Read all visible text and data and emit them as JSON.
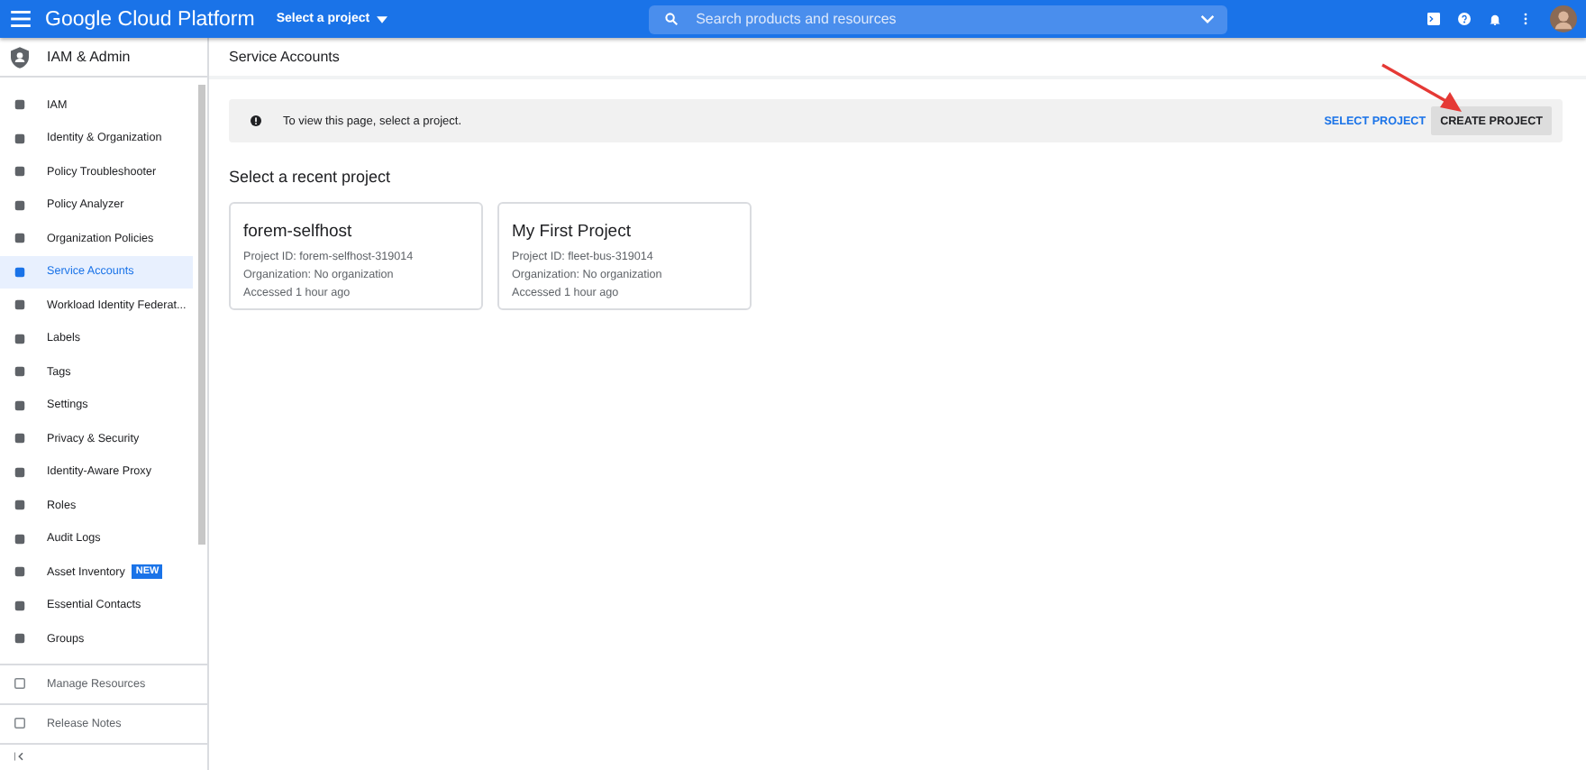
{
  "topbar": {
    "product": "Google Cloud Platform",
    "project_picker": "Select a project",
    "search": {
      "placeholder": "Search products and resources"
    }
  },
  "sidebar": {
    "title": "IAM & Admin",
    "items": [
      {
        "label": "IAM",
        "selected": false
      },
      {
        "label": "Identity & Organization",
        "selected": false
      },
      {
        "label": "Policy Troubleshooter",
        "selected": false
      },
      {
        "label": "Policy Analyzer",
        "selected": false
      },
      {
        "label": "Organization Policies",
        "selected": false
      },
      {
        "label": "Service Accounts",
        "selected": true
      },
      {
        "label": "Workload Identity Federat...",
        "selected": false
      },
      {
        "label": "Labels",
        "selected": false
      },
      {
        "label": "Tags",
        "selected": false
      },
      {
        "label": "Settings",
        "selected": false
      },
      {
        "label": "Privacy & Security",
        "selected": false
      },
      {
        "label": "Identity-Aware Proxy",
        "selected": false
      },
      {
        "label": "Roles",
        "selected": false
      },
      {
        "label": "Audit Logs",
        "selected": false
      },
      {
        "label": "Asset Inventory",
        "selected": false,
        "badge": "NEW"
      },
      {
        "label": "Essential Contacts",
        "selected": false
      },
      {
        "label": "Groups",
        "selected": false
      }
    ],
    "footer_items": [
      "Manage Resources",
      "Release Notes"
    ]
  },
  "page": {
    "title": "Service Accounts",
    "banner": {
      "message": "To view this page, select a project.",
      "actions": [
        "SELECT PROJECT",
        "CREATE PROJECT"
      ]
    },
    "recent_heading": "Select a recent project",
    "projects": [
      {
        "name": "forem-selfhost",
        "id": "Project ID: forem-selfhost-319014",
        "organization": "Organization: No organization",
        "accessed": "Accessed 1 hour ago"
      },
      {
        "name": "My First Project",
        "id": "Project ID: fleet-bus-319014",
        "organization": "Organization: No organization",
        "accessed": "Accessed 1 hour ago"
      }
    ]
  }
}
